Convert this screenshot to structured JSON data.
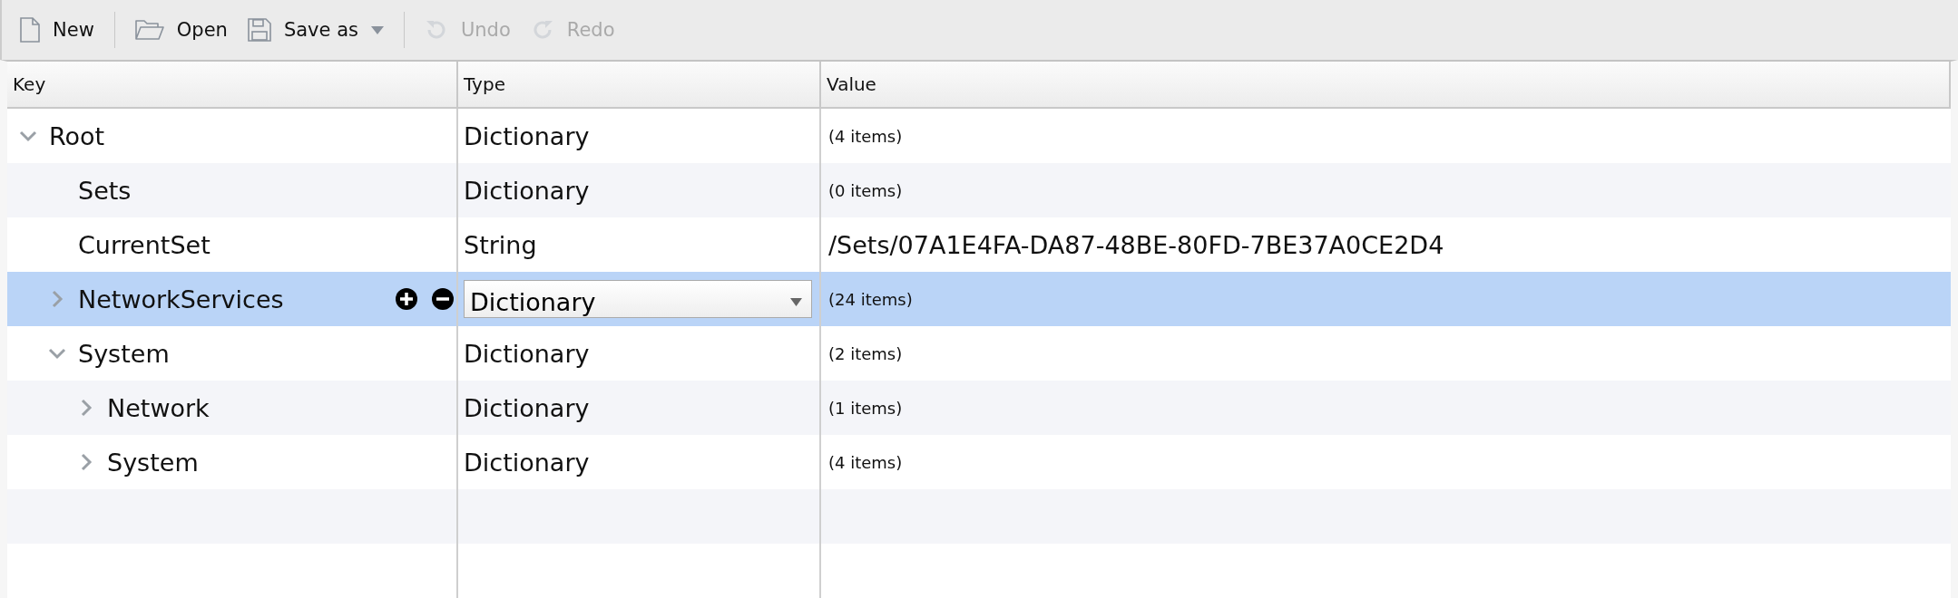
{
  "toolbar": [
    [
      {
        "label": "New",
        "disabled": false,
        "menu": false
      }
    ],
    [
      {
        "label": "Open",
        "disabled": false,
        "menu": false
      },
      {
        "label": "Save as",
        "disabled": false,
        "menu": true
      }
    ],
    [
      {
        "label": "Undo",
        "disabled": true,
        "menu": false
      },
      {
        "label": "Redo",
        "disabled": true,
        "menu": false
      }
    ]
  ],
  "table": {
    "columns": [
      "Key",
      "Type",
      "Value"
    ],
    "tree": [
      {
        "key": "Root",
        "type": "Dictionary",
        "value": "(4 items)",
        "kind": "count",
        "selected": false,
        "expanded": true,
        "children": [
          {
            "key": "Sets",
            "type": "Dictionary",
            "value": "(0 items)",
            "kind": "count",
            "selected": false
          },
          {
            "key": "CurrentSet",
            "type": "String",
            "value": "/Sets/07A1E4FA-DA87-48BE-80FD-7BE37A0CE2D4",
            "kind": "string",
            "selected": false
          },
          {
            "key": "NetworkServices",
            "type": "Dictionary",
            "value": "(24 items)",
            "kind": "count",
            "selected": true,
            "expanded": false
          },
          {
            "key": "System",
            "type": "Dictionary",
            "value": "(2 items)",
            "kind": "count",
            "selected": false,
            "expanded": true,
            "children": [
              {
                "key": "Network",
                "type": "Dictionary",
                "value": "(1 items)",
                "kind": "count",
                "selected": false,
                "expanded": false
              },
              {
                "key": "System",
                "type": "Dictionary",
                "value": "(4 items)",
                "kind": "count",
                "selected": false,
                "expanded": false
              }
            ]
          }
        ]
      }
    ]
  }
}
